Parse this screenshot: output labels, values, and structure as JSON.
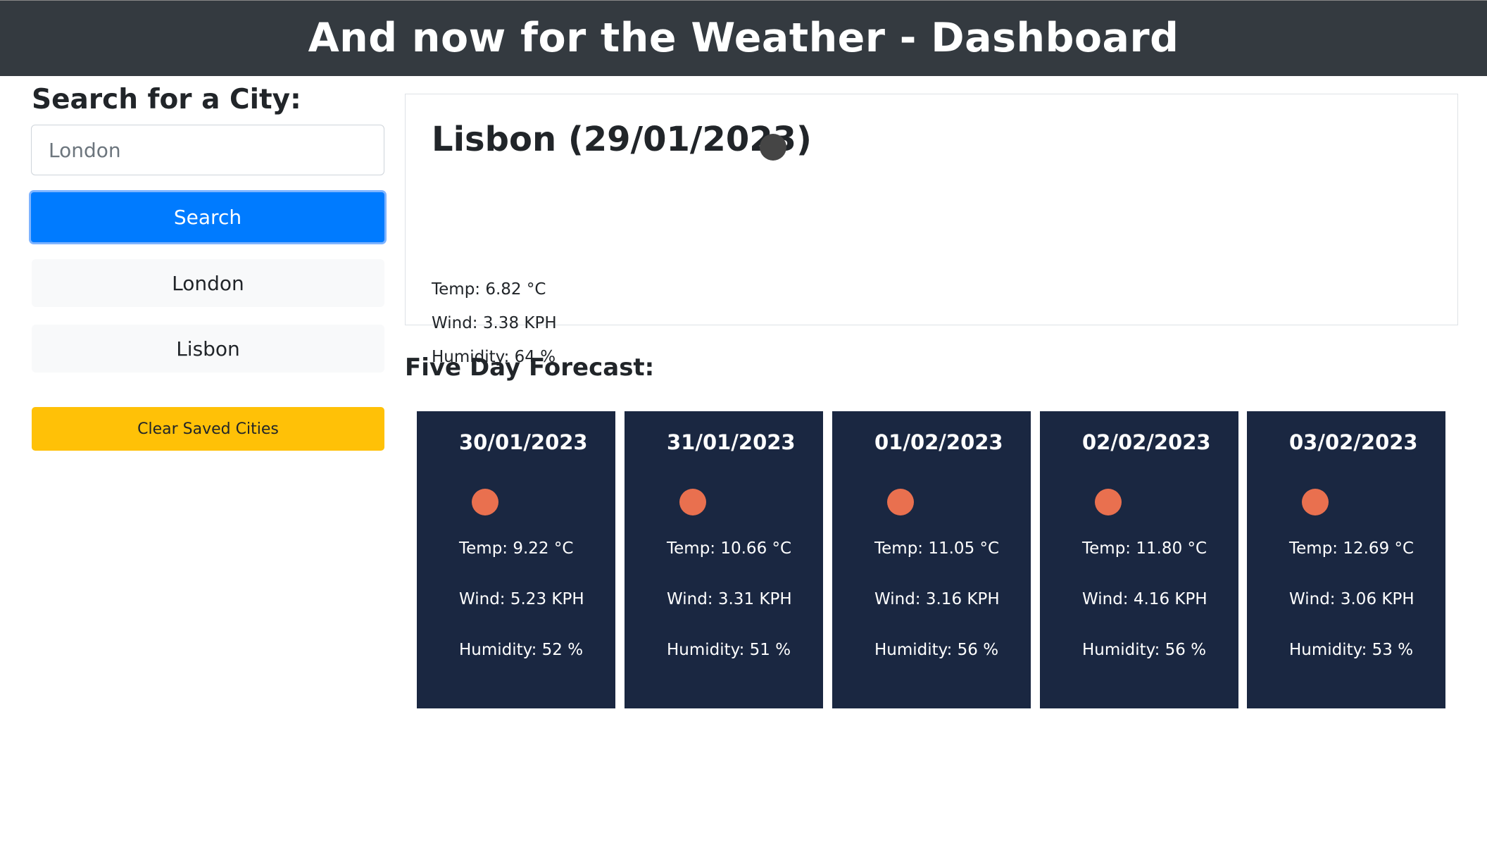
{
  "header": {
    "title": "And now for the Weather - Dashboard"
  },
  "sidebar": {
    "heading": "Search for a City:",
    "search_placeholder": "London",
    "search_button": "Search",
    "saved_cities": [
      "London",
      "Lisbon"
    ],
    "clear_button": "Clear Saved Cities"
  },
  "current": {
    "title": "Lisbon (29/01/2023)",
    "temp": "Temp: 6.82 °C",
    "wind": "Wind: 3.38 KPH",
    "humidity": "Humidity: 64 %",
    "icon_color": "#454545"
  },
  "forecast": {
    "heading": "Five Day Forecast:",
    "icon_color": "#e9704f",
    "card_color": "#1a2741",
    "days": [
      {
        "date": "30/01/2023",
        "temp": "Temp: 9.22 °C",
        "wind": "Wind: 5.23 KPH",
        "humidity": "Humidity: 52 %"
      },
      {
        "date": "31/01/2023",
        "temp": "Temp: 10.66 °C",
        "wind": "Wind: 3.31 KPH",
        "humidity": "Humidity: 51 %"
      },
      {
        "date": "01/02/2023",
        "temp": "Temp: 11.05 °C",
        "wind": "Wind: 3.16 KPH",
        "humidity": "Humidity: 56 %"
      },
      {
        "date": "02/02/2023",
        "temp": "Temp: 11.80 °C",
        "wind": "Wind: 4.16 KPH",
        "humidity": "Humidity: 56 %"
      },
      {
        "date": "03/02/2023",
        "temp": "Temp: 12.69 °C",
        "wind": "Wind: 3.06 KPH",
        "humidity": "Humidity: 53 %"
      }
    ]
  }
}
